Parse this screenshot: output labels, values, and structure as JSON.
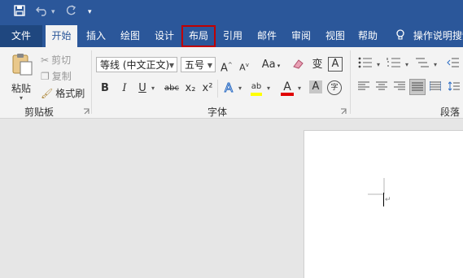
{
  "quick_access": {
    "save_icon": "save-icon",
    "undo_icon": "undo-icon",
    "redo_icon": "redo-icon",
    "customize_icon": "customize-icon"
  },
  "tabs": {
    "file": "文件",
    "home": "开始",
    "insert": "插入",
    "draw": "绘图",
    "design": "设计",
    "layout": "布局",
    "references": "引用",
    "mailings": "邮件",
    "review": "审阅",
    "view": "视图",
    "help": "帮助",
    "tell_me": "操作说明搜索"
  },
  "clipboard": {
    "paste": "粘贴",
    "cut": "剪切",
    "copy": "复制",
    "format_painter": "格式刷",
    "group_label": "剪贴板"
  },
  "font": {
    "font_name": "等线 (中文正文)",
    "font_size": "五号",
    "group_label": "字体",
    "grow": "A",
    "shrink": "A",
    "change_case": "Aa",
    "phonetic": "变",
    "char_border": "A",
    "bold": "B",
    "italic": "I",
    "underline": "U",
    "strikethrough": "abc",
    "subscript": "x₂",
    "superscript": "x²",
    "text_effects": "A",
    "highlight": "ab",
    "font_color": "A",
    "char_shading": "A",
    "enclose": "字"
  },
  "paragraph": {
    "group_label": "段落"
  },
  "colors": {
    "brand": "#2b579a",
    "highlight_box": "#c00000",
    "font_color_bar": "#e00000",
    "highlight_bar": "#ffff00"
  }
}
